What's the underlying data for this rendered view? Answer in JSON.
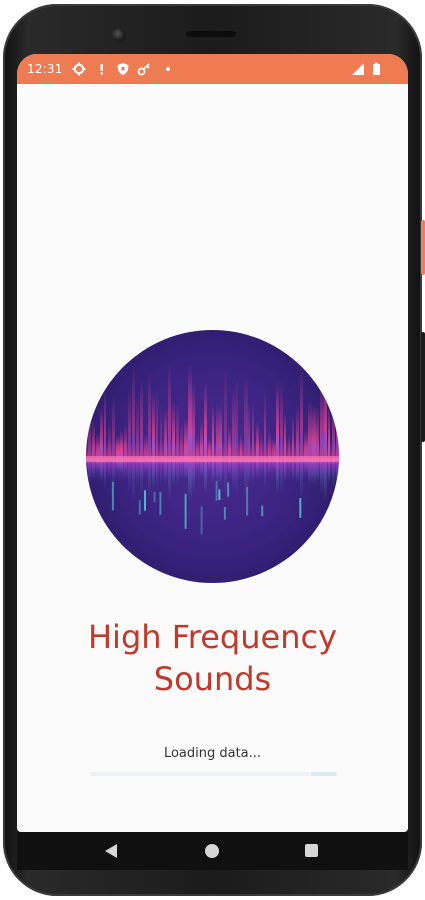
{
  "status_bar": {
    "time": "12:31",
    "left_icons": [
      "settings-icon",
      "notification-icon",
      "shield-icon",
      "key-icon",
      "dot-icon"
    ],
    "right_icons": [
      "signal-icon",
      "battery-icon"
    ],
    "background_color": "#ef7b53"
  },
  "app": {
    "logo": "sound-wave-logo",
    "title_line1": "High Frequency",
    "title_line2": "Sounds",
    "title_color": "#c0392b",
    "loading_text": "Loading data..."
  },
  "progress": {
    "indeterminate": true,
    "fill_color": "#dce8f6",
    "track_color": "#f0f2f5"
  },
  "nav_bar": {
    "buttons": [
      "back-button",
      "home-button",
      "recents-button"
    ]
  }
}
